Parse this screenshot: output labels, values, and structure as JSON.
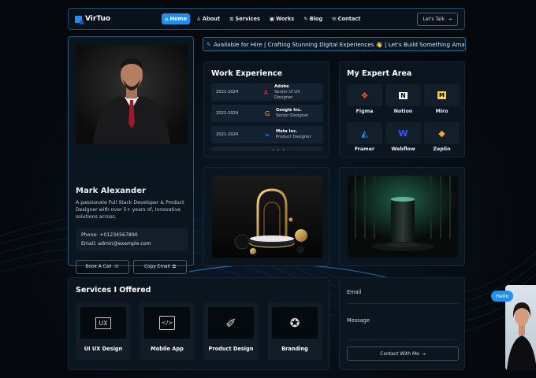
{
  "brand": {
    "name": "VirTuo"
  },
  "nav": {
    "items": [
      {
        "label": "Home",
        "icon": "home-icon",
        "active": true
      },
      {
        "label": "About",
        "icon": "user-icon",
        "active": false
      },
      {
        "label": "Services",
        "icon": "layers-icon",
        "active": false
      },
      {
        "label": "Works",
        "icon": "briefcase-icon",
        "active": false
      },
      {
        "label": "Blog",
        "icon": "edit-icon",
        "active": false
      },
      {
        "label": "Contact",
        "icon": "mail-icon",
        "active": false
      }
    ],
    "cta": "Let's Talk"
  },
  "ticker": {
    "text": "Available for Hire | Crafting Stunning Digital Experiences 👋 | Let's Build Something Ama"
  },
  "profile": {
    "name": "Mark Alexander",
    "bio": "A passionate Full Stack Developer & Product Designer with over 5+ years of, Innovative solutions across.",
    "phone": "Phone: +01234567890",
    "email": "Email: admin@example.com",
    "book_call": "Book A Call",
    "copy_email": "Copy Email",
    "socials": [
      "instagram-icon",
      "linkedin-icon",
      "twitter-icon",
      "facebook-icon"
    ]
  },
  "work": {
    "title": "Work Experience",
    "jobs": [
      {
        "years": "2021-2024",
        "company": "Adobe",
        "role": "Senior UI UX Designer"
      },
      {
        "years": "2021-2024",
        "company": "Google Inc.",
        "role": "Senior Designer"
      },
      {
        "years": "2021-2024",
        "company": "Meta Inc.",
        "role": "Product Designer"
      }
    ]
  },
  "expert": {
    "title": "My Expert Area",
    "tools": [
      "Figma",
      "Notion",
      "Miro",
      "Framer",
      "Webflow",
      "Zeplin"
    ]
  },
  "services": {
    "title": "Services I Offered",
    "items": [
      "UI UX Design",
      "Mobile App",
      "Product Design",
      "Branding"
    ]
  },
  "form": {
    "email_label": "Email",
    "message_label": "Message",
    "submit": "Contact With Me"
  },
  "widget": {
    "hello": "Hello"
  },
  "colors": {
    "accent": "#1f8ff0",
    "background": "#05080c",
    "card": "#0b1520"
  }
}
